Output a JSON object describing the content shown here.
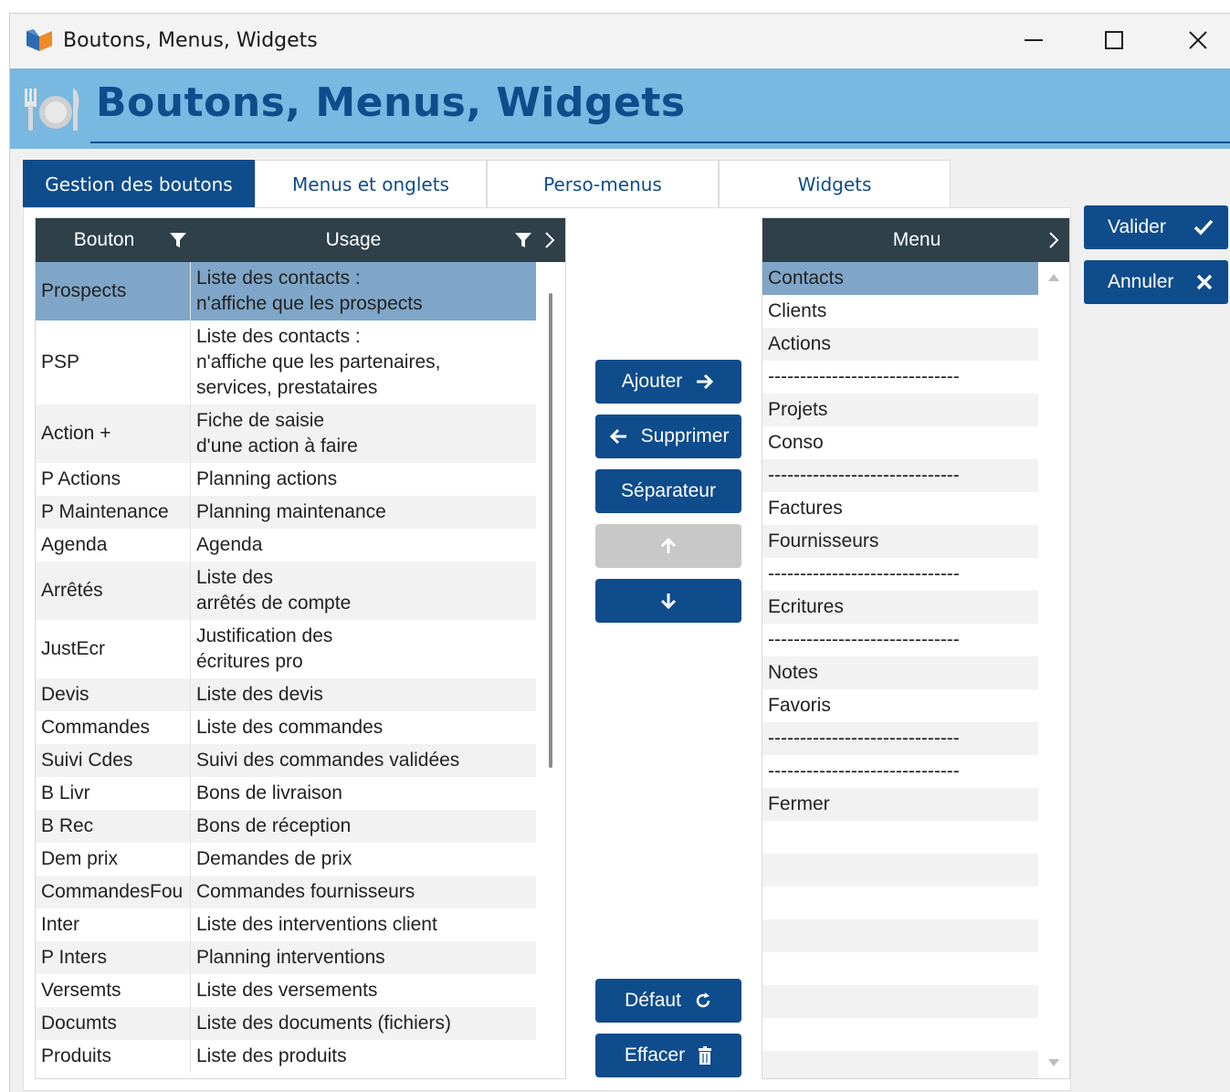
{
  "window": {
    "title": "Boutons, Menus, Widgets",
    "minimize_icon": "minimize-icon",
    "maximize_icon": "maximize-icon",
    "close_icon": "close-icon"
  },
  "banner": {
    "title": "Boutons, Menus, Widgets",
    "icon": "restaurant-icon"
  },
  "tabs": [
    {
      "label": "Gestion des boutons",
      "active": true
    },
    {
      "label": "Menus et onglets",
      "active": false
    },
    {
      "label": "Perso-menus",
      "active": false
    },
    {
      "label": "Widgets",
      "active": false
    }
  ],
  "left_table": {
    "columns": {
      "bouton": "Bouton",
      "usage": "Usage"
    },
    "rows": [
      {
        "bouton": "Prospects",
        "usage": [
          "Liste des contacts :",
          "n'affiche que les prospects"
        ],
        "selected": true
      },
      {
        "bouton": "PSP",
        "usage": [
          "Liste des contacts :",
          "n'affiche que les partenaires,",
          "services, prestataires"
        ]
      },
      {
        "bouton": "Action +",
        "usage": [
          "Fiche de saisie",
          "d'une action à faire"
        ]
      },
      {
        "bouton": "P Actions",
        "usage": [
          "Planning actions"
        ]
      },
      {
        "bouton": "P Maintenance",
        "usage": [
          "Planning maintenance"
        ]
      },
      {
        "bouton": "Agenda",
        "usage": [
          "Agenda"
        ]
      },
      {
        "bouton": "Arrêtés",
        "usage": [
          "Liste des",
          "arrêtés de compte"
        ]
      },
      {
        "bouton": "JustEcr",
        "usage": [
          "Justification des",
          "écritures pro"
        ]
      },
      {
        "bouton": "Devis",
        "usage": [
          "Liste des devis"
        ]
      },
      {
        "bouton": "Commandes",
        "usage": [
          "Liste des commandes"
        ]
      },
      {
        "bouton": "Suivi Cdes",
        "usage": [
          "Suivi des commandes validées"
        ]
      },
      {
        "bouton": "B Livr",
        "usage": [
          "Bons de livraison"
        ]
      },
      {
        "bouton": "B Rec",
        "usage": [
          "Bons de réception"
        ]
      },
      {
        "bouton": "Dem prix",
        "usage": [
          "Demandes de prix"
        ]
      },
      {
        "bouton": "CommandesFou",
        "usage": [
          "Commandes fournisseurs"
        ]
      },
      {
        "bouton": "Inter",
        "usage": [
          "Liste des interventions client"
        ]
      },
      {
        "bouton": "P Inters",
        "usage": [
          "Planning interventions"
        ]
      },
      {
        "bouton": "Versemts",
        "usage": [
          "Liste des versements"
        ]
      },
      {
        "bouton": "Documts",
        "usage": [
          "Liste des documents (fichiers)"
        ]
      },
      {
        "bouton": "Produits",
        "usage": [
          "Liste des produits"
        ]
      }
    ]
  },
  "middle_buttons": {
    "ajouter": "Ajouter",
    "supprimer": "Supprimer",
    "separateur": "Séparateur",
    "defaut": "Défaut",
    "effacer": "Effacer"
  },
  "menu_list": {
    "header": "Menu",
    "items": [
      "Contacts",
      "Clients",
      "Actions",
      "------------------------------",
      "Projets",
      "Conso",
      "------------------------------",
      "Factures",
      "Fournisseurs",
      "------------------------------",
      "Ecritures",
      "------------------------------",
      "Notes",
      "Favoris",
      "------------------------------",
      "------------------------------",
      "Fermer",
      "",
      "",
      "",
      "",
      "",
      "",
      "",
      ""
    ]
  },
  "side_buttons": {
    "valider": "Valider",
    "annuler": "Annuler"
  }
}
